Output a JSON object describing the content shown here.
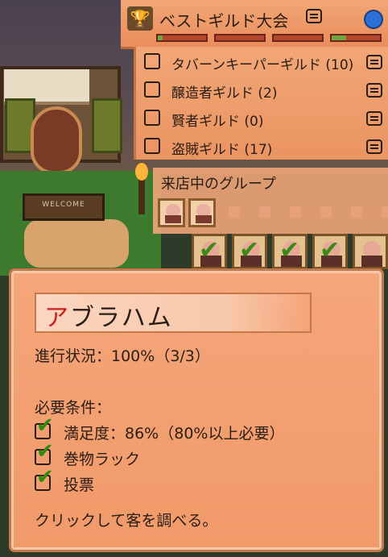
{
  "contest": {
    "title": "ベストギルド大会",
    "progress_bars": [
      {
        "fill": 0.1
      },
      {
        "fill": 0.0
      },
      {
        "fill": 0.0
      },
      {
        "fill": 0.3
      }
    ]
  },
  "guilds": [
    {
      "label": "タバーンキーパーギルド (10)"
    },
    {
      "label": "醸造者ギルド (2)"
    },
    {
      "label": "賢者ギルド (0)"
    },
    {
      "label": "盗賊ギルド (17)"
    }
  ],
  "visiting": {
    "title": "来店中のグループ",
    "filled_slots": 2,
    "empty_slots": 6
  },
  "queue": {
    "checked_count": 4,
    "unchecked_count": 1
  },
  "customer": {
    "name_first": "ア",
    "name_rest": "ブラハム",
    "progress": "進行状況：100%（3/3）",
    "requirements_title": "必要条件：",
    "requirements": [
      {
        "label": "満足度：86%（80%以上必要）",
        "checked": true
      },
      {
        "label": "巻物ラック",
        "checked": true
      },
      {
        "label": "投票",
        "checked": true
      }
    ],
    "hint": "クリックして客を調べる。"
  },
  "scene": {
    "sign_text": "WELCOME"
  },
  "colors": {
    "panel": "#f19a6a",
    "accent_red": "#c8231e",
    "check_green": "#2f8a10"
  }
}
